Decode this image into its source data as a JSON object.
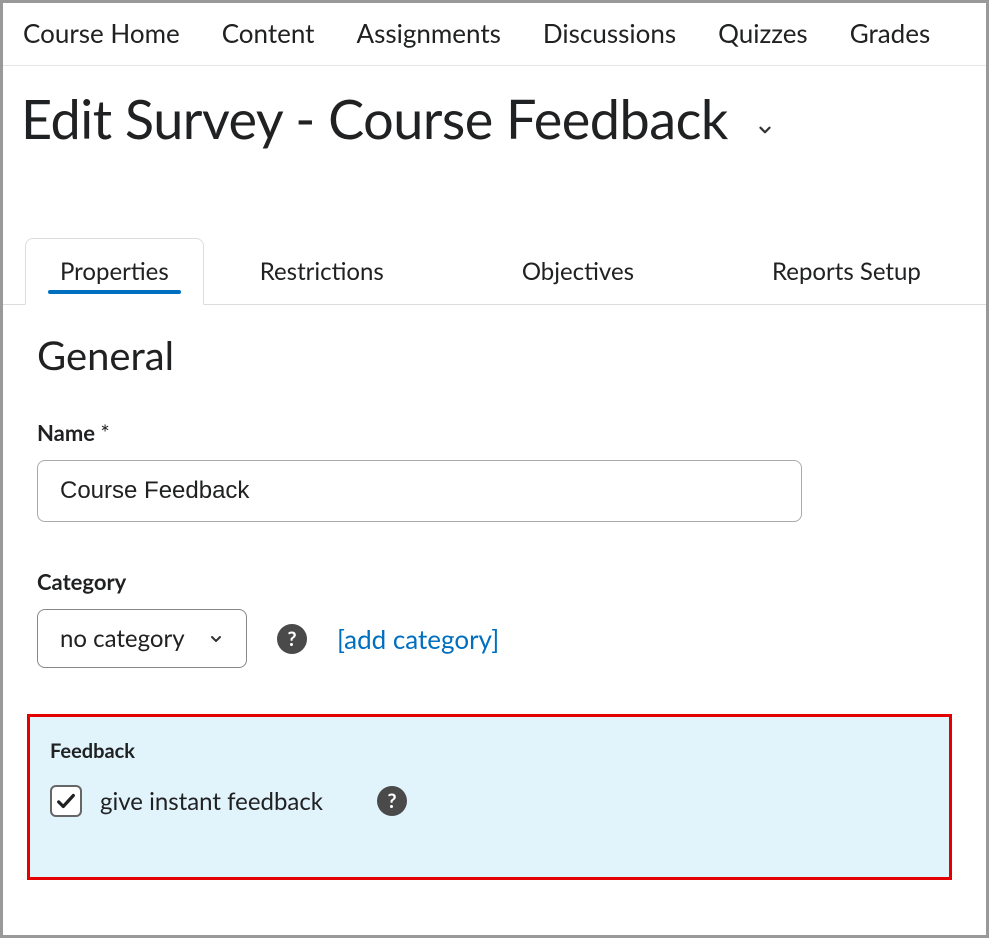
{
  "nav": {
    "items": [
      "Course Home",
      "Content",
      "Assignments",
      "Discussions",
      "Quizzes",
      "Grades"
    ]
  },
  "title": "Edit Survey - Course Feedback",
  "tabs": [
    "Properties",
    "Restrictions",
    "Objectives",
    "Reports Setup"
  ],
  "active_tab_index": 0,
  "general": {
    "heading": "General",
    "name_label": "Name",
    "name_required_marker": "*",
    "name_value": "Course Feedback",
    "category_label": "Category",
    "category_selected": "no category",
    "add_category_link": "[add category]"
  },
  "feedback": {
    "section_label": "Feedback",
    "checkbox_checked": true,
    "checkbox_label": "give instant feedback"
  }
}
